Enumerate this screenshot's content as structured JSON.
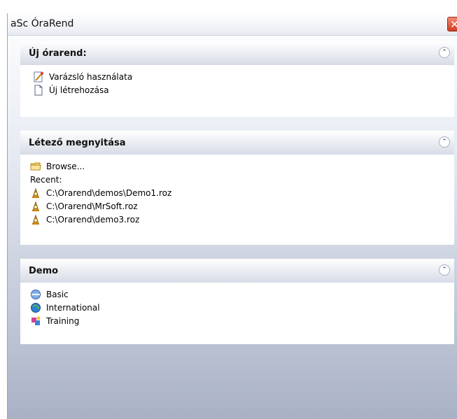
{
  "window": {
    "title": "aSc ÓraRend",
    "close_glyph": "✕"
  },
  "panels": [
    {
      "title": "Új órarend:",
      "collapse_glyph": "⌃",
      "items": [
        {
          "label": "Varázsló használata",
          "icon": "wizard-icon"
        },
        {
          "label": "Új létrehozása",
          "icon": "new-document-icon"
        }
      ]
    },
    {
      "title": "Létező megnyitása",
      "collapse_glyph": "⌃",
      "browse": {
        "label": "Browse...",
        "icon": "folder-icon"
      },
      "recent_label": "Recent:",
      "recent_files": [
        {
          "label": "C:\\Orarend\\demos\\Demo1.roz",
          "icon": "roz-file-icon"
        },
        {
          "label": "C:\\Orarend\\MrSoft.roz",
          "icon": "roz-file-icon"
        },
        {
          "label": "C:\\Orarend\\demo3.roz",
          "icon": "roz-file-icon"
        }
      ]
    },
    {
      "title": "Demo",
      "collapse_glyph": "⌃",
      "items": [
        {
          "label": "Basic",
          "icon": "basic-demo-icon"
        },
        {
          "label": "International",
          "icon": "globe-icon"
        },
        {
          "label": "Training",
          "icon": "training-demo-icon"
        }
      ]
    }
  ],
  "colors": {
    "close": "#d9472b",
    "window_gradient_bottom": "#a9b1c6"
  }
}
